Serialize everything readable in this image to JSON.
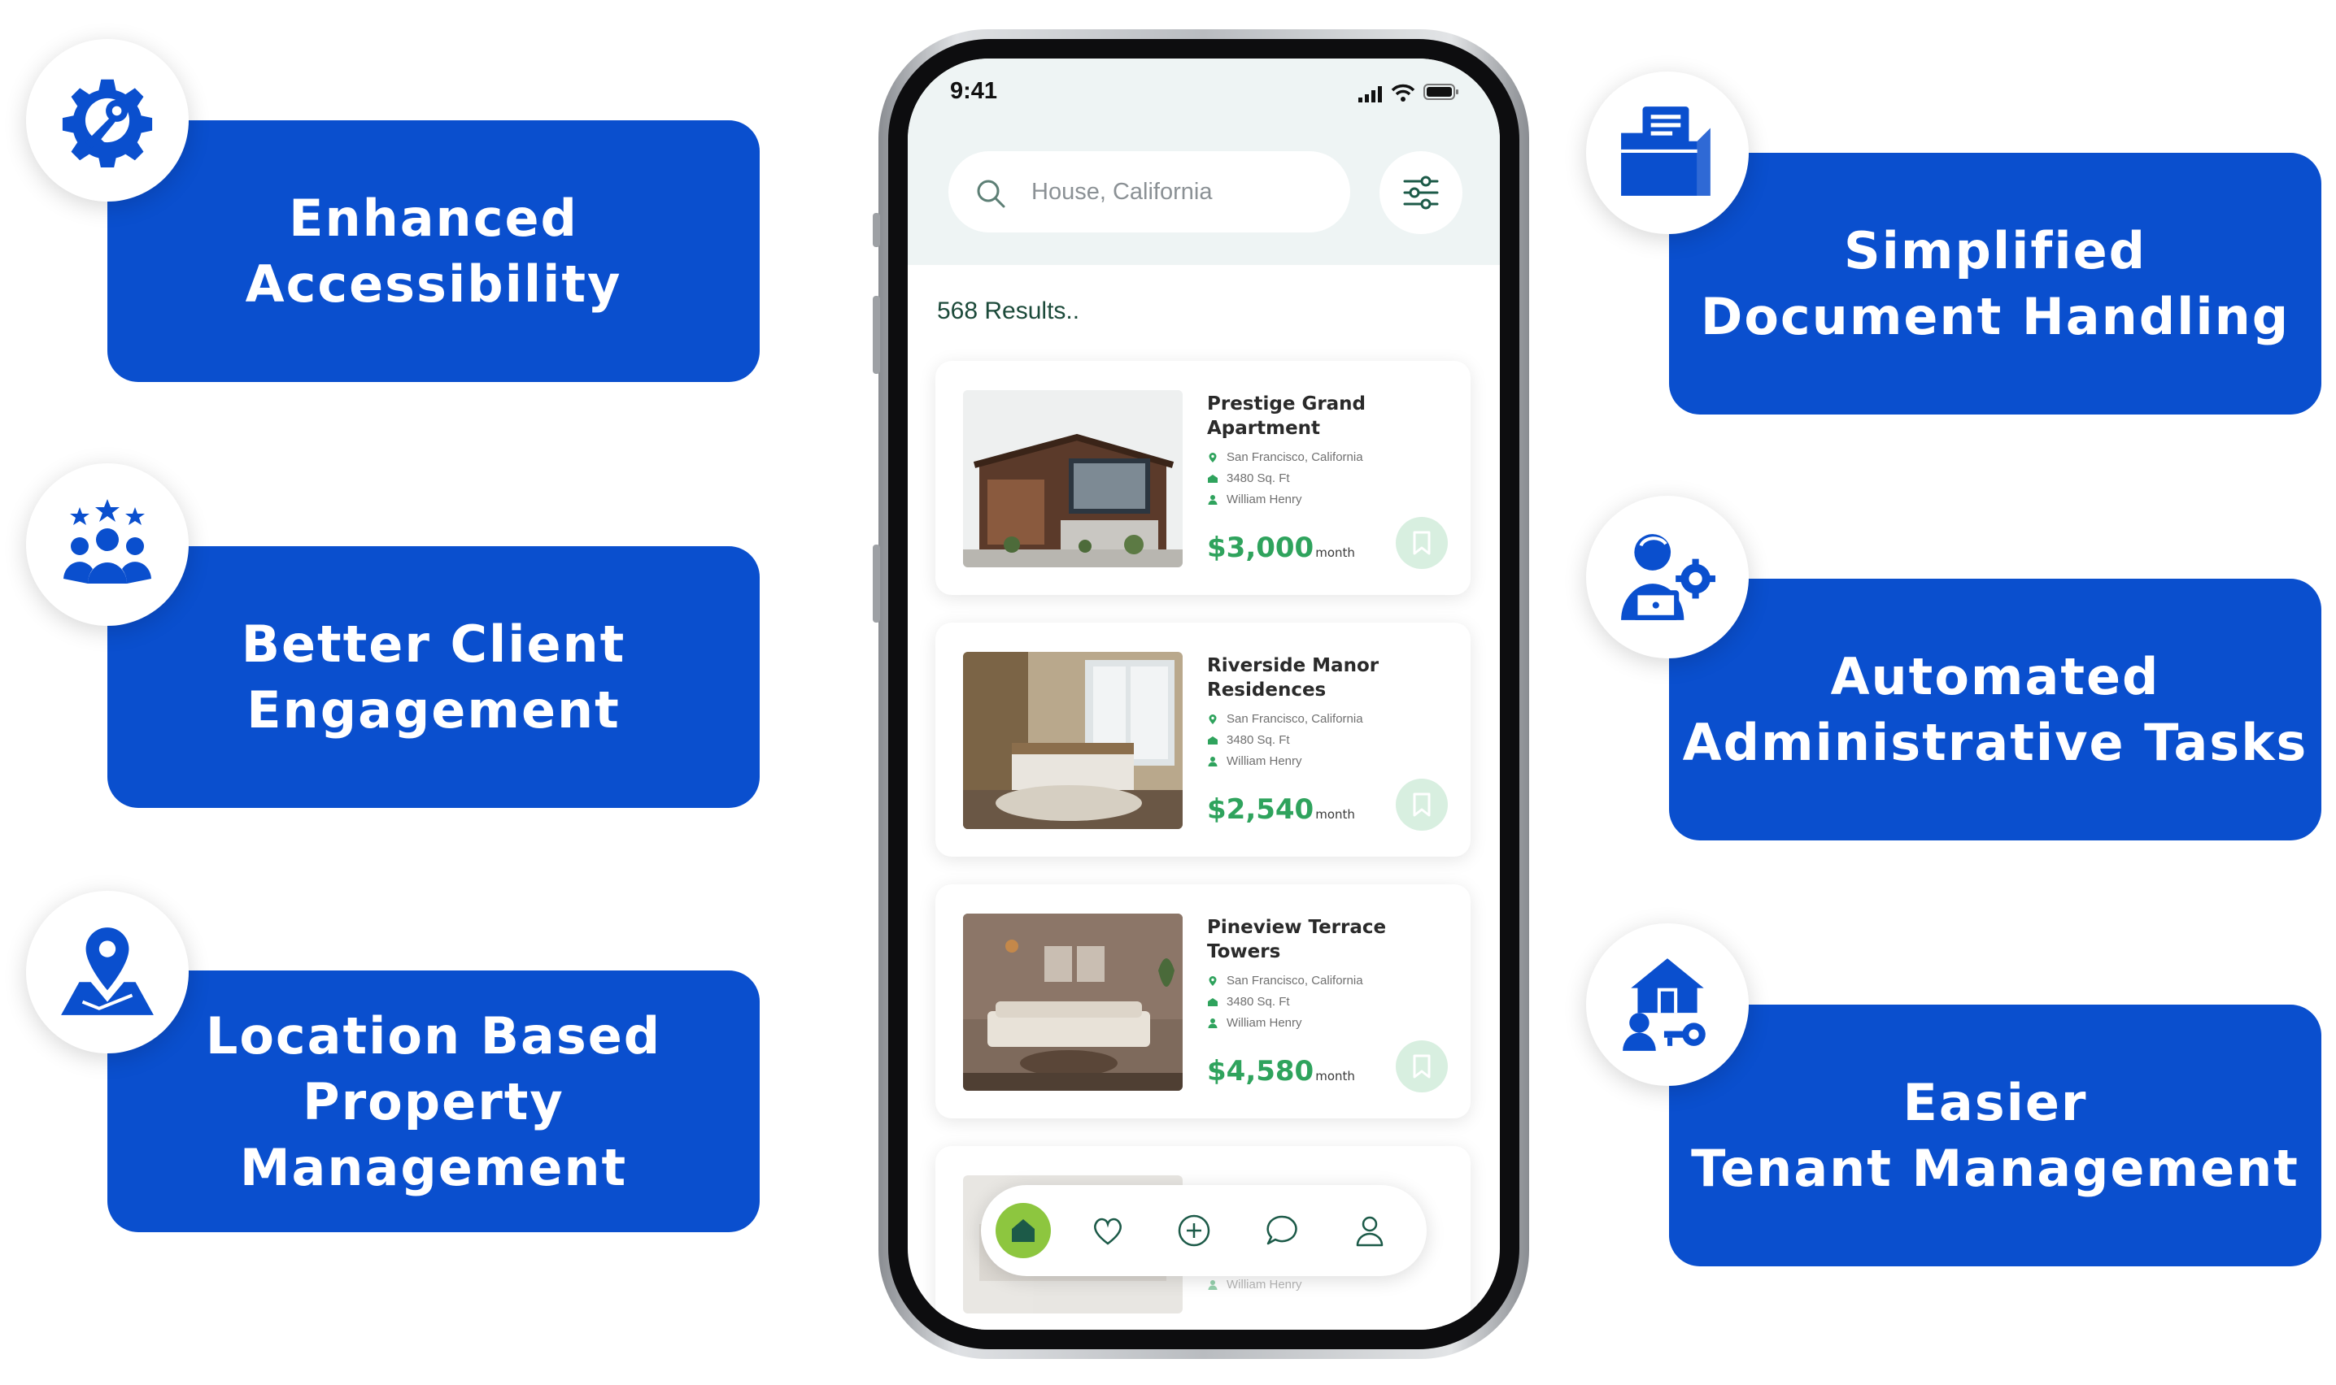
{
  "features_left": [
    {
      "icon": "gear-key-icon",
      "line1": "Enhanced",
      "line2": "Accessibility"
    },
    {
      "icon": "team-stars-icon",
      "line1": "Better Client",
      "line2": "Engagement"
    },
    {
      "icon": "map-pin-icon",
      "line1": "Location Based",
      "line2": "Property Management"
    }
  ],
  "features_right": [
    {
      "icon": "folder-documents-icon",
      "line1": "Simplified",
      "line2": "Document Handling"
    },
    {
      "icon": "user-laptop-gear-icon",
      "line1": "Automated",
      "line2": "Administrative Tasks"
    },
    {
      "icon": "house-tenant-key-icon",
      "line1": "Easier",
      "line2": "Tenant Management"
    }
  ],
  "phone": {
    "status_time": "9:41",
    "search_placeholder": "House, California",
    "results_text": "568 Results..",
    "listings": [
      {
        "title_line1": "Prestige Grand",
        "title_line2": "Apartment",
        "location": "San Francisco, California",
        "area": "3480 Sq. Ft",
        "agent": "William Henry",
        "price": "$3,000",
        "unit": "month"
      },
      {
        "title_line1": "Riverside Manor",
        "title_line2": "Residences",
        "location": "San Francisco, California",
        "area": "3480 Sq. Ft",
        "agent": "William Henry",
        "price": "$2,540",
        "unit": "month"
      },
      {
        "title_line1": "Pineview Terrace",
        "title_line2": "Towers",
        "location": "San Francisco, California",
        "area": "3480 Sq. Ft",
        "agent": "William Henry",
        "price": "$4,580",
        "unit": "month"
      }
    ],
    "partial_card_agent": "William Henry",
    "nav": [
      "home-icon",
      "heart-icon",
      "add-icon",
      "chat-icon",
      "profile-icon"
    ]
  },
  "colors": {
    "feature_blue": "#0a4fce",
    "app_green": "#2fa35d",
    "nav_accent": "#8dc63f"
  }
}
